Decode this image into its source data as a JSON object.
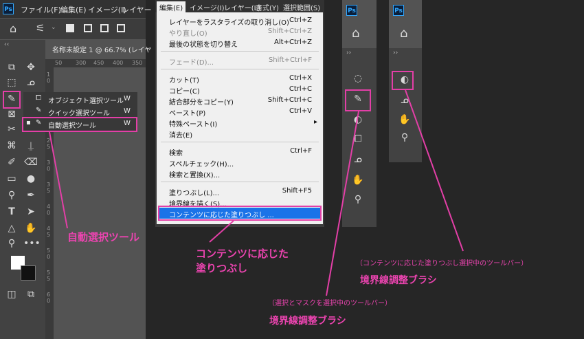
{
  "panel1": {
    "ps_logo": "Ps",
    "menu": [
      "ファイル(F)",
      "編集(E)",
      "イメージ(I)",
      "レイヤー"
    ],
    "doc_tab": "名称未設定 1 @ 66.7% (レイヤ",
    "ruler_h": [
      "50",
      "300",
      "450",
      "400",
      "350"
    ],
    "ruler_v": [
      "1 0",
      "1 5",
      "2 0",
      "2 5",
      "3 0",
      "3 5",
      "4 0",
      "4 5",
      "5 0",
      "5 5",
      "6 0"
    ],
    "collapse": "‹‹",
    "flyout": [
      {
        "label": "オブジェクト選択ツール",
        "shortcut": "W"
      },
      {
        "label": "クイック選択ツール",
        "shortcut": "W"
      },
      {
        "label": "自動選択ツール",
        "shortcut": "W"
      }
    ]
  },
  "panel2": {
    "menu": [
      "編集(E)",
      "イメージ(I)",
      "レイヤー(L)",
      "書式(Y)",
      "選択範囲(S)"
    ],
    "items": [
      {
        "label": "レイヤーをラスタライズの取り消し(O)",
        "shortcut": "Ctrl+Z",
        "disabled": false
      },
      {
        "label": "やり直し(O)",
        "shortcut": "Shift+Ctrl+Z",
        "disabled": true
      },
      {
        "label": "最後の状態を切り替え",
        "shortcut": "Alt+Ctrl+Z",
        "disabled": false
      },
      {
        "label": "フェード(D)...",
        "shortcut": "Shift+Ctrl+F",
        "disabled": true
      },
      {
        "label": "カット(T)",
        "shortcut": "Ctrl+X",
        "disabled": false
      },
      {
        "label": "コピー(C)",
        "shortcut": "Ctrl+C",
        "disabled": false
      },
      {
        "label": "結合部分をコピー(Y)",
        "shortcut": "Shift+Ctrl+C",
        "disabled": false
      },
      {
        "label": "ペースト(P)",
        "shortcut": "Ctrl+V",
        "disabled": false
      },
      {
        "label": "特殊ペースト(I)",
        "shortcut": "▸",
        "disabled": false
      },
      {
        "label": "消去(E)",
        "shortcut": "",
        "disabled": false
      },
      {
        "label": "検索",
        "shortcut": "Ctrl+F",
        "disabled": false
      },
      {
        "label": "スペルチェック(H)...",
        "shortcut": "",
        "disabled": false
      },
      {
        "label": "検索と置換(X)...",
        "shortcut": "",
        "disabled": false
      },
      {
        "label": "塗りつぶし(L)...",
        "shortcut": "Shift+F5",
        "disabled": false
      },
      {
        "label": "境界線を描く(S)...",
        "shortcut": "",
        "disabled": false
      },
      {
        "label": "コンテンツに応じた塗りつぶし ...",
        "shortcut": "",
        "disabled": false
      }
    ]
  },
  "panel3": {
    "ps_logo": "Ps",
    "collapse": "››"
  },
  "panel4": {
    "ps_logo": "Ps",
    "collapse": "››"
  },
  "annotations": {
    "auto_select": "自動選択ツール",
    "content_fill_line1": "コンテンツに応じた",
    "content_fill_line2": "塗りつぶし",
    "toolbar_content_fill_note": "（コンテンツに応じた塗りつぶし選択中のツールバー）",
    "boundary_brush_1": "境界線調整ブラシ",
    "toolbar_mask_note": "（選択とマスクを選択中のツールバー）",
    "boundary_brush_2": "境界線調整ブラシ"
  },
  "colors": {
    "accent": "#e33fa7",
    "highlight": "#1a73e8",
    "ps_blue": "#31a8ff",
    "menu_bg": "#f0f0f0",
    "panel": "#424242"
  }
}
